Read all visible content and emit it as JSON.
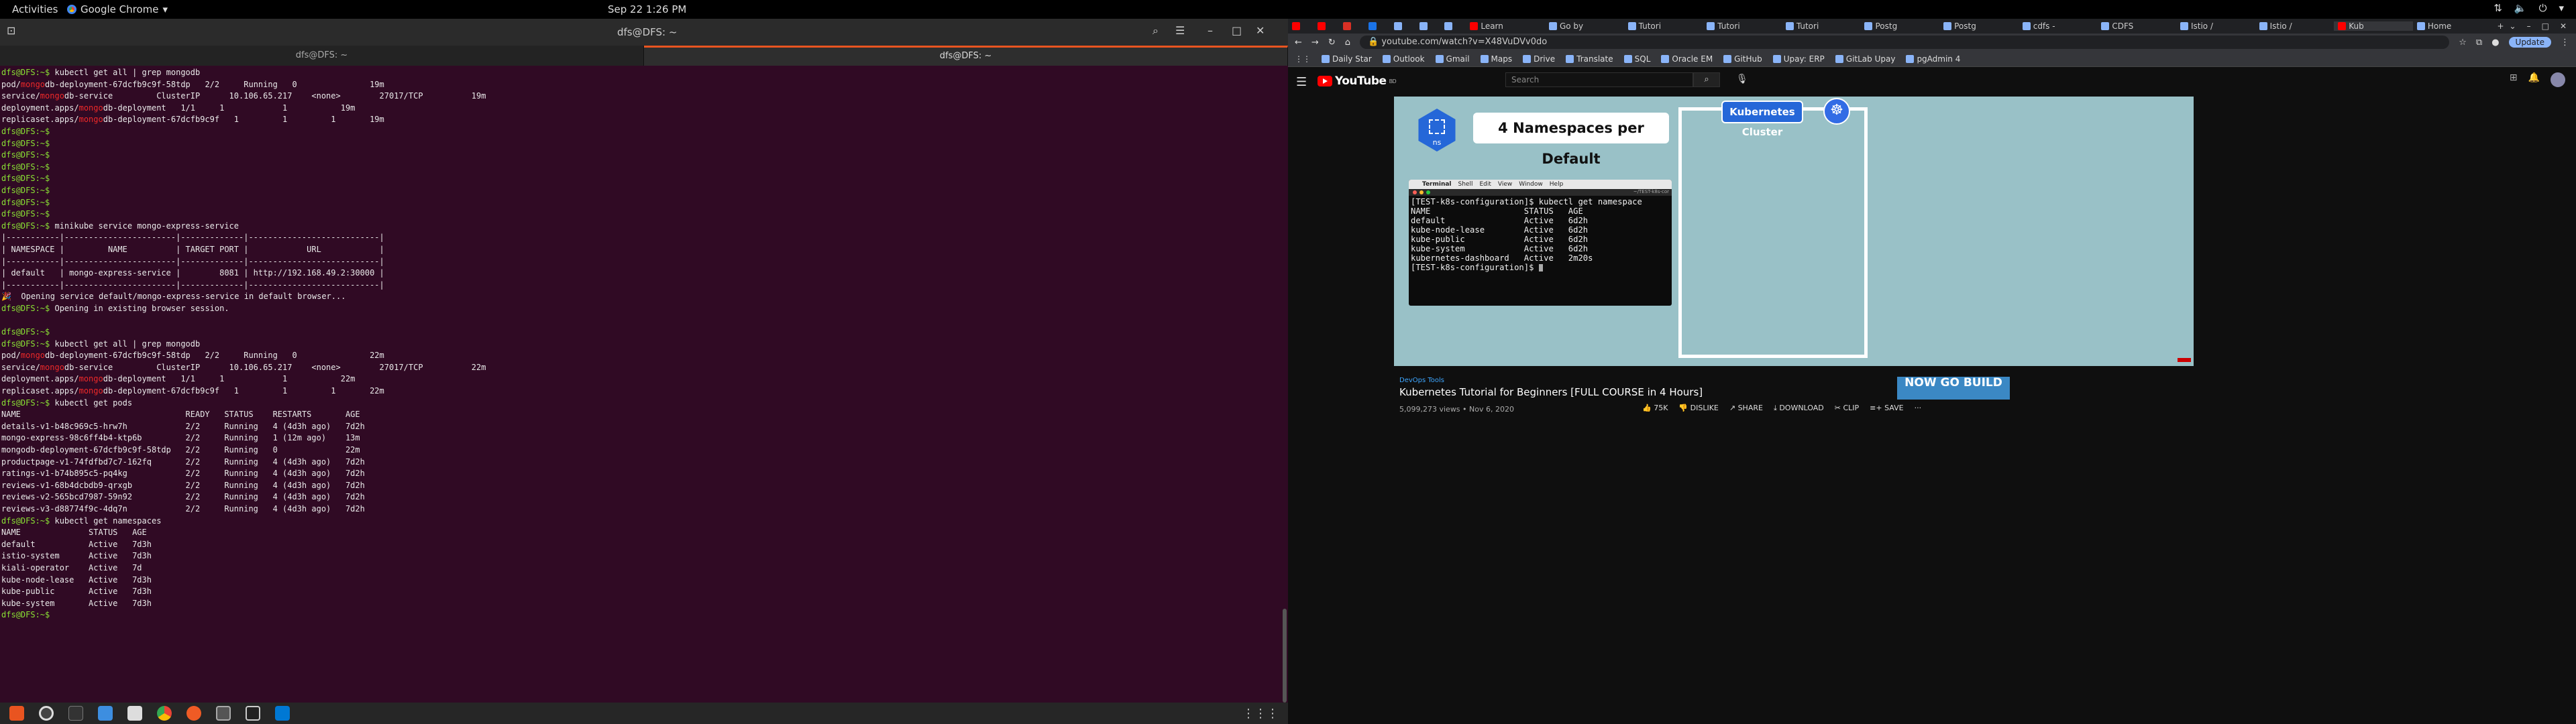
{
  "system_bar": {
    "activities": "Activities",
    "app_name": "Google Chrome",
    "clock": "Sep 22  1:26 PM"
  },
  "terminal": {
    "window_title": "dfs@DFS: ~",
    "tabs": [
      "dfs@DFS: ~",
      "dfs@DFS: ~"
    ],
    "lines": [
      "dfs@DFS:~$ kubectl get all | grep mongodb",
      "pod/mongodb-deployment-67dcfb9c9f-58tdp   2/2     Running   0               19m",
      "service/mongodb-service         ClusterIP      10.106.65.217    <none>        27017/TCP          19m",
      "deployment.apps/mongodb-deployment   1/1     1            1           19m",
      "replicaset.apps/mongodb-deployment-67dcfb9c9f   1         1         1       19m",
      "dfs@DFS:~$",
      "dfs@DFS:~$",
      "dfs@DFS:~$",
      "dfs@DFS:~$",
      "dfs@DFS:~$",
      "dfs@DFS:~$",
      "dfs@DFS:~$",
      "dfs@DFS:~$",
      "dfs@DFS:~$ minikube service mongo-express-service",
      "|-----------|-----------------------|-------------|---------------------------|",
      "| NAMESPACE |         NAME          | TARGET PORT |            URL            |",
      "|-----------|-----------------------|-------------|---------------------------|",
      "| default   | mongo-express-service |        8081 | http://192.168.49.2:30000 |",
      "|-----------|-----------------------|-------------|---------------------------|",
      "🎉  Opening service default/mongo-express-service in default browser...",
      "dfs@DFS:~$ Opening in existing browser session.",
      "",
      "dfs@DFS:~$",
      "dfs@DFS:~$ kubectl get all | grep mongodb",
      "pod/mongodb-deployment-67dcfb9c9f-58tdp   2/2     Running   0               22m",
      "service/mongodb-service         ClusterIP      10.106.65.217    <none>        27017/TCP          22m",
      "deployment.apps/mongodb-deployment   1/1     1            1           22m",
      "replicaset.apps/mongodb-deployment-67dcfb9c9f   1         1         1       22m",
      "dfs@DFS:~$ kubectl get pods",
      "NAME                                  READY   STATUS    RESTARTS       AGE",
      "details-v1-b48c969c5-hrw7h            2/2     Running   4 (4d3h ago)   7d2h",
      "mongo-express-98c6ff4b4-ktp6b         2/2     Running   1 (12m ago)    13m",
      "mongodb-deployment-67dcfb9c9f-58tdp   2/2     Running   0              22m",
      "productpage-v1-74fdfbd7c7-162fq       2/2     Running   4 (4d3h ago)   7d2h",
      "ratings-v1-b74b895c5-pq4kg            2/2     Running   4 (4d3h ago)   7d2h",
      "reviews-v1-68b4dcbdb9-qrxgb           2/2     Running   4 (4d3h ago)   7d2h",
      "reviews-v2-565bcd7987-59n92           2/2     Running   4 (4d3h ago)   7d2h",
      "reviews-v3-d88774f9c-4dq7n            2/2     Running   4 (4d3h ago)   7d2h",
      "dfs@DFS:~$ kubectl get namespaces",
      "NAME              STATUS   AGE",
      "default           Active   7d3h",
      "istio-system      Active   7d3h",
      "kiali-operator    Active   7d",
      "kube-node-lease   Active   7d3h",
      "kube-public       Active   7d3h",
      "kube-system       Active   7d3h",
      "dfs@DFS:~$ "
    ],
    "colors": {
      "background": "#300a24",
      "prompt": "#8ae234",
      "highlight": "#ef2929"
    }
  },
  "dock": {
    "icons": [
      "ubuntu-software-icon",
      "disk-usage-icon",
      "terminal-icon",
      "files-icon",
      "text-editor-icon",
      "chrome-icon",
      "postman-icon",
      "screenshot-icon",
      "vim-icon",
      "vscode-icon"
    ]
  },
  "chrome": {
    "tabs": [
      {
        "label": "",
        "icon": "youtube",
        "small": true
      },
      {
        "label": "",
        "icon": "yt",
        "small": true
      },
      {
        "label": "",
        "icon": "gmail",
        "small": true
      },
      {
        "label": "",
        "icon": "drive",
        "small": true
      },
      {
        "label": "",
        "icon": "misc",
        "small": true
      },
      {
        "label": "",
        "icon": "misc",
        "small": true
      },
      {
        "label": "",
        "icon": "misc",
        "small": true
      },
      {
        "label": "Learn",
        "icon": "youtube",
        "small": false
      },
      {
        "label": "Go by",
        "icon": "misc",
        "small": false
      },
      {
        "label": "Tutori",
        "icon": "misc",
        "small": false
      },
      {
        "label": "Tutori",
        "icon": "misc",
        "small": false
      },
      {
        "label": "Tutori",
        "icon": "misc",
        "small": false
      },
      {
        "label": "Postg",
        "icon": "misc",
        "small": false
      },
      {
        "label": "Postg",
        "icon": "misc",
        "small": false
      },
      {
        "label": "cdfs -",
        "icon": "misc",
        "small": false
      },
      {
        "label": "CDFS",
        "icon": "misc",
        "small": false
      },
      {
        "label": "Istio /",
        "icon": "misc",
        "small": false
      },
      {
        "label": "Istio /",
        "icon": "misc",
        "small": false
      },
      {
        "label": "Kub",
        "icon": "youtube",
        "small": false,
        "active": true
      },
      {
        "label": "Home",
        "icon": "misc",
        "small": false
      }
    ],
    "url": "youtube.com/watch?v=X48VuDVv0do",
    "update_label": "Update",
    "bookmarks": [
      "Daily Star",
      "Outlook",
      "Gmail",
      "Maps",
      "Drive",
      "Translate",
      "SQL",
      "Oracle EM",
      "GitHub",
      "Upay: ERP",
      "GitLab Upay",
      "pgAdmin 4"
    ]
  },
  "youtube": {
    "logo_text": "YouTube",
    "logo_region": "BD",
    "search_placeholder": "Search",
    "player": {
      "ns_icon_label": "ns",
      "headline": "4 Namespaces per Default",
      "cluster_label": "Kubernetes Cluster",
      "mac_menu": [
        "Terminal",
        "Shell",
        "Edit",
        "View",
        "Window",
        "Help"
      ],
      "tab_name": "~/TEST-k8s-cor",
      "shot_lines": [
        "[TEST-k8s-configuration]$ kubectl get namespace",
        "NAME                   STATUS   AGE",
        "default                Active   6d2h",
        "kube-node-lease        Active   6d2h",
        "kube-public            Active   6d2h",
        "kube-system            Active   6d2h",
        "kubernetes-dashboard   Active   2m20s",
        "[TEST-k8s-configuration]$ "
      ]
    },
    "channel": "DevOps Tools",
    "title": "Kubernetes Tutorial for Beginners [FULL COURSE in 4 Hours]",
    "meta": "5,099,273 views • Nov 6, 2020",
    "actions": {
      "likes": "75K",
      "dislike": "DISLIKE",
      "share": "SHARE",
      "download": "DOWNLOAD",
      "clip": "CLIP",
      "save": "SAVE",
      "more": "···"
    },
    "ad_text": "NOW GO BUILD"
  }
}
